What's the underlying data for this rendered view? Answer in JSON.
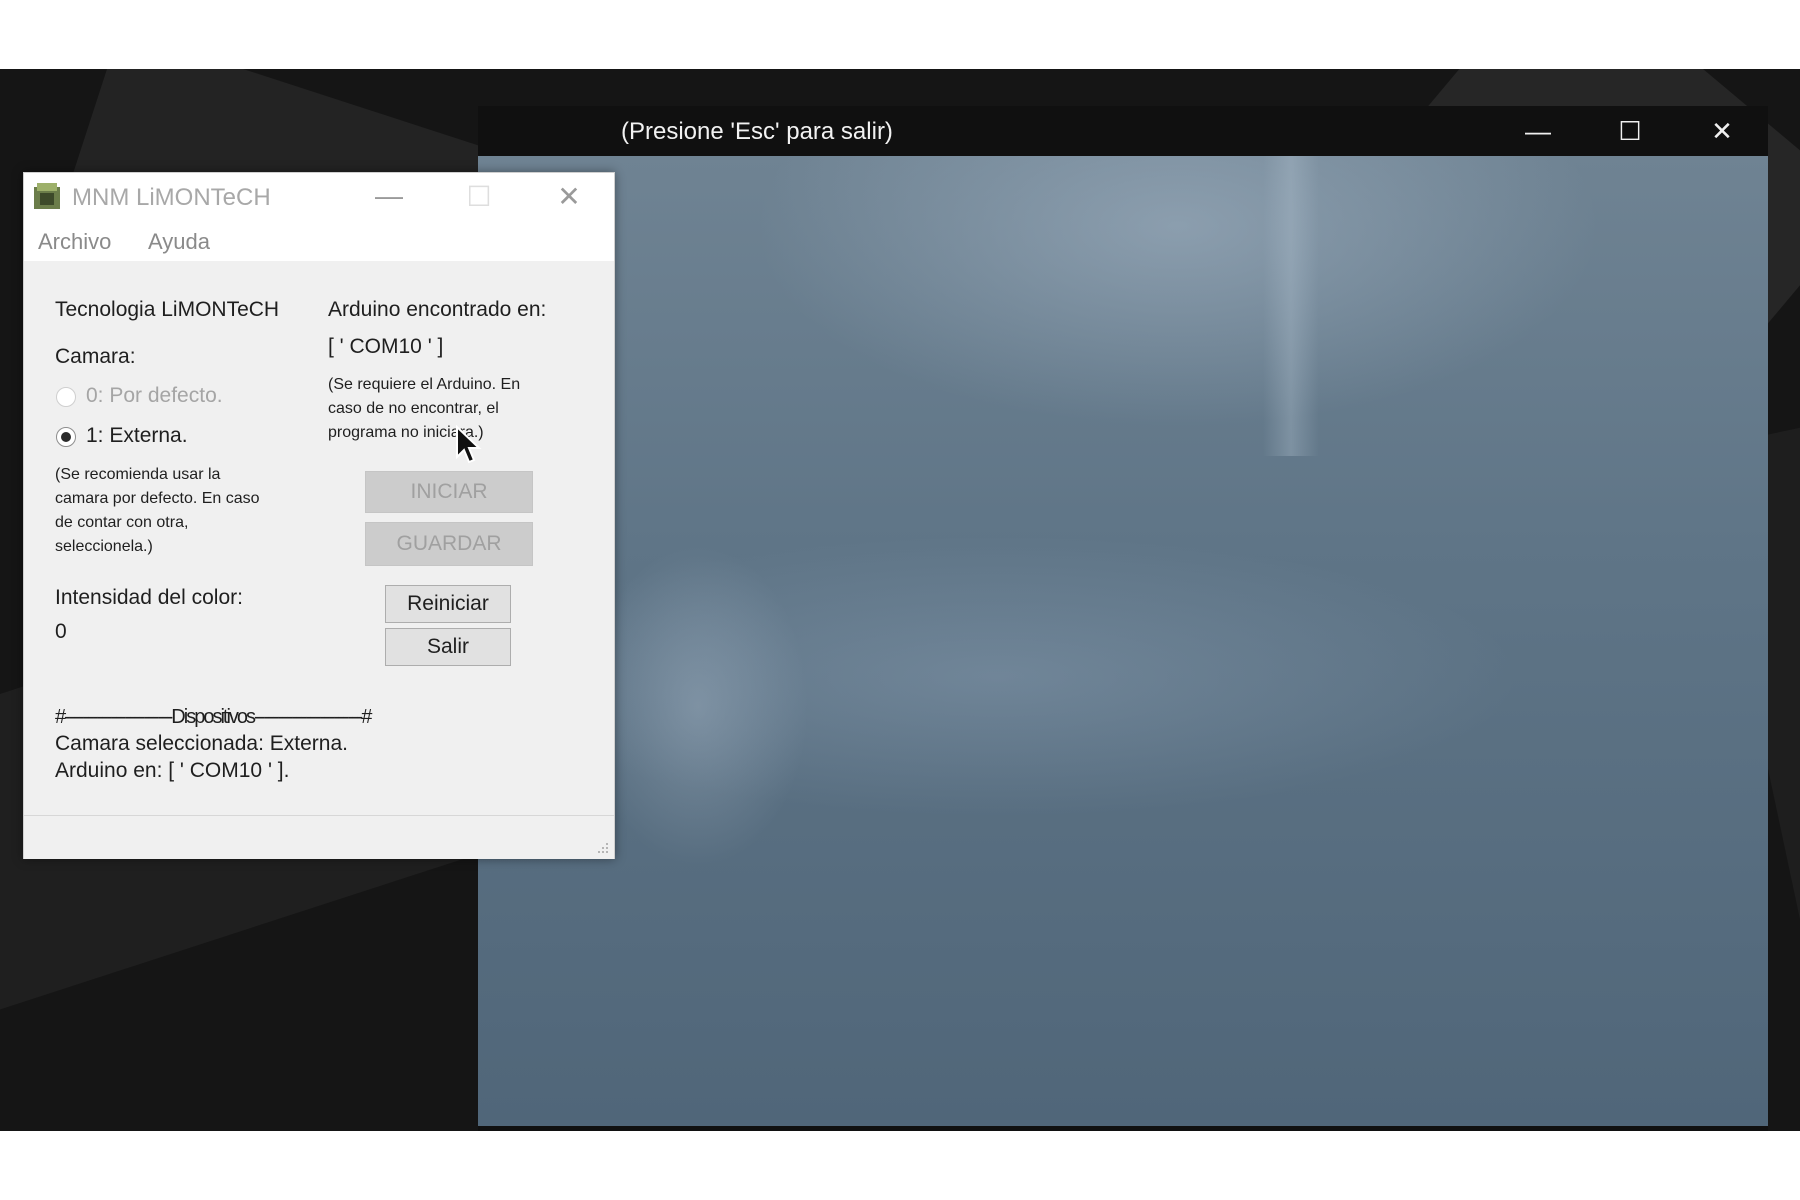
{
  "camera_window": {
    "title": "(Presione 'Esc' para salir)",
    "controls": {
      "minimize": "—",
      "maximize": "☐",
      "close": "✕"
    }
  },
  "app": {
    "title": "MNM LiMONTeCH",
    "controls": {
      "minimize": "—",
      "maximize": "☐",
      "close": "✕"
    },
    "menu": [
      "Archivo",
      "Ayuda"
    ],
    "brand_label": "Tecnologia LiMONTeCH",
    "camera_label": "Camara:",
    "camera_options": [
      {
        "label": "0: Por defecto.",
        "selected": false,
        "enabled": false
      },
      {
        "label": "1: Externa.",
        "selected": true,
        "enabled": true
      }
    ],
    "camera_note": "(Se recomienda usar la camara por defecto. En caso de contar con otra, seleccionela.)",
    "color_intensity_label": "Intensidad del color:",
    "color_intensity_value": "0",
    "arduino_label": "Arduino encontrado en:",
    "arduino_port": "[ ' COM10 ' ]",
    "arduino_note": "(Se requiere el Arduino. En caso de no encontrar, el programa no iniciara.)",
    "buttons": {
      "start": "INICIAR",
      "save": "GUARDAR",
      "restart": "Reiniciar",
      "exit": "Salir"
    },
    "devices_header": "#-----------------------Dispositivos-----------------------#",
    "devices_camera": "Camara seleccionada: Externa.",
    "devices_arduino": "Arduino en: [ ' COM10 ' ]."
  }
}
